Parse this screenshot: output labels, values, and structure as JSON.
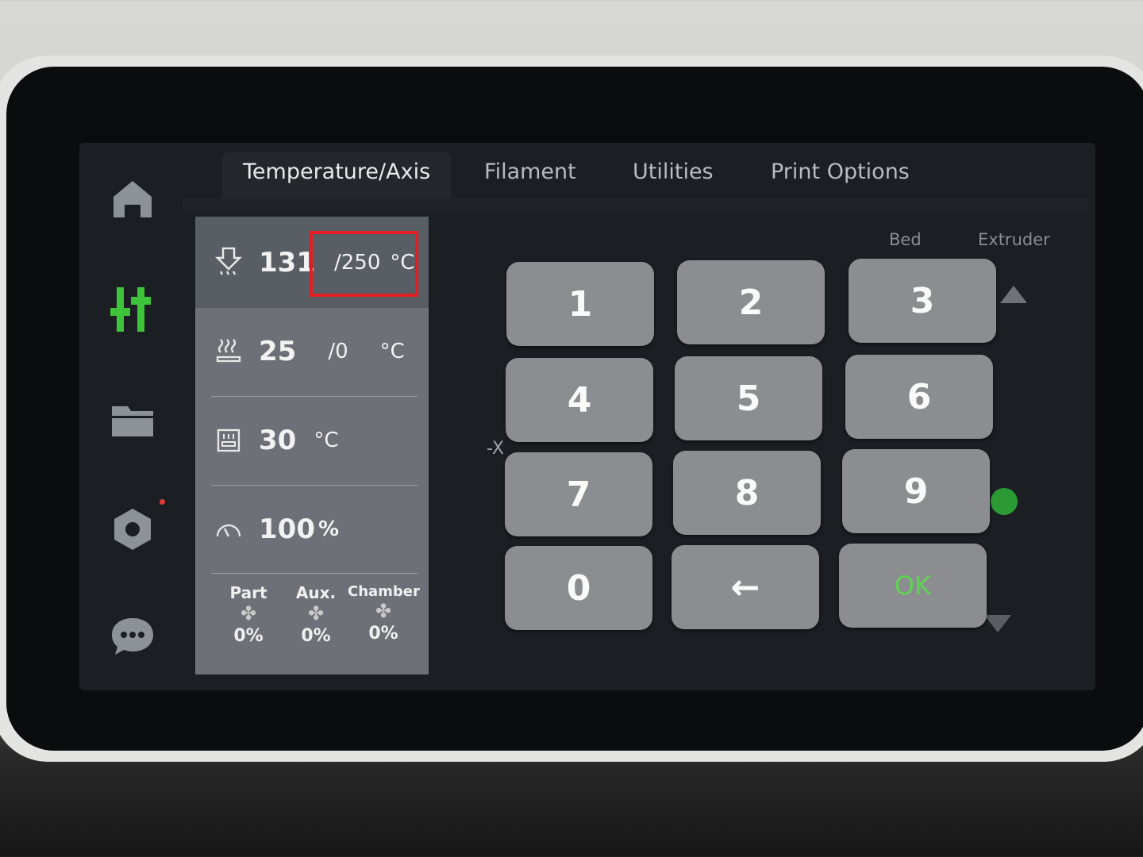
{
  "sidebar": {
    "items": [
      {
        "name": "home",
        "icon": "home-icon"
      },
      {
        "name": "controls",
        "icon": "sliders-icon",
        "active": true
      },
      {
        "name": "files",
        "icon": "folder-icon"
      },
      {
        "name": "settings",
        "icon": "hexagon-nut-icon",
        "notification": true
      },
      {
        "name": "messages",
        "icon": "chat-bubble-icon"
      }
    ]
  },
  "tabs": [
    {
      "label": "Temperature/Axis",
      "active": true
    },
    {
      "label": "Filament"
    },
    {
      "label": "Utilities"
    },
    {
      "label": "Print Options"
    }
  ],
  "temps": {
    "nozzle": {
      "current": "131",
      "target": "/250",
      "unit": "°C"
    },
    "bed": {
      "current": "25",
      "target": "/0",
      "unit": "°C"
    },
    "chamber": {
      "current": "30",
      "unit": "°C"
    },
    "speed": {
      "value": "100",
      "unit": "%"
    }
  },
  "fans": [
    {
      "label": "Part",
      "value": "0%"
    },
    {
      "label": "Aux.",
      "value": "0%"
    },
    {
      "label": "Chamber",
      "value": "0%"
    }
  ],
  "keypad": {
    "keys": [
      "1",
      "2",
      "3",
      "4",
      "5",
      "6",
      "7",
      "8",
      "9",
      "0"
    ],
    "backspace": "←",
    "ok": "OK"
  },
  "background_controls": {
    "bed_label": "Bed",
    "extruder_label": "Extruder",
    "minus_x": "-X"
  },
  "colors": {
    "accent": "#3ec43a",
    "ok_text": "#5fd452",
    "highlight": "#e51c22"
  }
}
